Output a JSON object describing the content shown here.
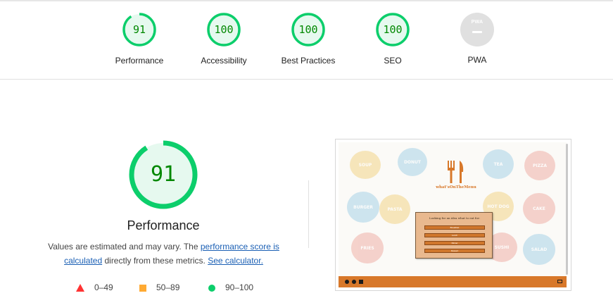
{
  "gauges": [
    {
      "label": "Performance",
      "score": "91",
      "value": 0.91
    },
    {
      "label": "Accessibility",
      "score": "100",
      "value": 1.0
    },
    {
      "label": "Best Practices",
      "score": "100",
      "value": 1.0
    },
    {
      "label": "SEO",
      "score": "100",
      "value": 1.0
    },
    {
      "label": "PWA",
      "score": "PWA",
      "value": null
    }
  ],
  "main": {
    "score": "91",
    "value": 0.91,
    "title": "Performance",
    "desc_prefix": "Values are estimated and may vary. The ",
    "desc_link1": "performance score is calculated",
    "desc_middle": " directly from these metrics. ",
    "desc_link2": "See calculator."
  },
  "legend": [
    {
      "label": "0–49",
      "shape": "triangle",
      "color": "#ff3333"
    },
    {
      "label": "50–89",
      "shape": "square",
      "color": "#ffaa33"
    },
    {
      "label": "90–100",
      "shape": "circle",
      "color": "#0cce6b"
    }
  ],
  "colors": {
    "pass": "#0cce6b",
    "pass_bg": "#e6f9ef",
    "pass_text": "#008800",
    "pwa": "#e0e0e0",
    "brand": "#d8782a"
  },
  "screenshot": {
    "site_name": "what'sOnTheMenu",
    "modal_title": "Looking for an idea what to eat for:",
    "buttons": [
      "Breakfast",
      "Lunch",
      "Dinner",
      "Dessert"
    ]
  }
}
